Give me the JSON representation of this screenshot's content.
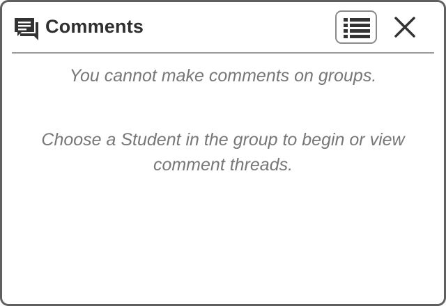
{
  "panel": {
    "title": "Comments",
    "icons": {
      "header": "comments-icon",
      "list_button": "list-icon",
      "close_button": "close-icon"
    }
  },
  "messages": {
    "line1": "You cannot make comments on groups.",
    "line2": "Choose a Student in the group to begin or view comment threads."
  },
  "colors": {
    "title": "#2f2f2f",
    "message": "#777777",
    "border": "#5f5f5f",
    "divider": "#9a9a9a"
  }
}
